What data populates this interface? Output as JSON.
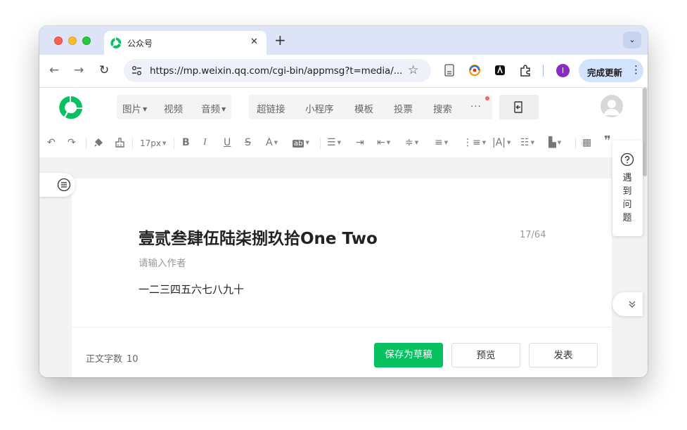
{
  "browser": {
    "tab_title": "公众号",
    "tab_close": "✕",
    "new_tab": "+",
    "tab_menu": "⌄",
    "url": "https://mp.weixin.qq.com/cgi-bin/appmsg?t=media/...",
    "profile_initial": "I",
    "update_label": "完成更新",
    "update_menu": "⋮",
    "accent": "#d3e3fd"
  },
  "editor_menu": {
    "group1": [
      {
        "label": "图片",
        "dropdown": true
      },
      {
        "label": "视频",
        "dropdown": false
      },
      {
        "label": "音频",
        "dropdown": true
      }
    ],
    "group2": [
      {
        "label": "超链接"
      },
      {
        "label": "小程序"
      },
      {
        "label": "模板"
      },
      {
        "label": "投票"
      },
      {
        "label": "搜索"
      },
      {
        "label": "···"
      }
    ]
  },
  "format_bar": {
    "font_size": "17px",
    "icons": [
      "undo-icon",
      "redo-icon",
      "format-painter-icon",
      "clear-format-icon",
      "bold-icon",
      "italic-icon",
      "underline-icon",
      "strikethrough-icon",
      "font-color-icon",
      "background-color-icon",
      "align-icon",
      "indent-icon",
      "outdent-icon",
      "line-height-icon",
      "paragraph-spacing-icon",
      "text-indent-icon",
      "letter-spacing-icon",
      "list-icon",
      "layout-icon",
      "table-icon",
      "quote-icon"
    ]
  },
  "article": {
    "title": "壹贰叁肆伍陆柒捌玖拾One Two",
    "title_count": "17/64",
    "author_placeholder": "请输入作者",
    "body": "一二三四五六七八九十"
  },
  "footer": {
    "word_count_label": "正文字数",
    "word_count": "10",
    "save_draft": "保存为草稿",
    "preview": "预览",
    "publish": "发表"
  },
  "help": {
    "text": "遇到问题"
  },
  "colors": {
    "brand_green": "#07c160",
    "tab_strip": "#dde4f8",
    "page_gray": "#f3f3f3"
  }
}
